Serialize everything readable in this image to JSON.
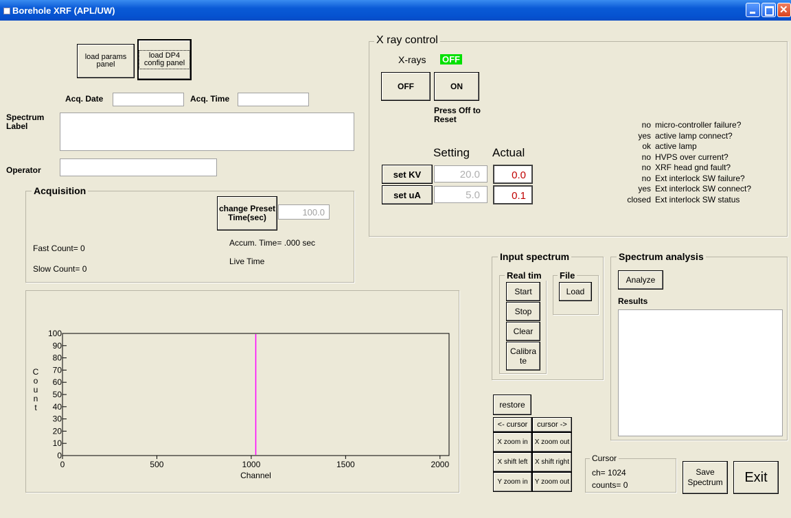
{
  "window": {
    "title": "Borehole XRF (APL/UW)"
  },
  "top_buttons": {
    "load_params": "load params panel",
    "load_dp4": "load DP4 config panel"
  },
  "acq": {
    "date_label": "Acq. Date",
    "time_label": "Acq. Time",
    "date_value": "",
    "time_value": ""
  },
  "spectrum_label": {
    "label": "Spectrum Label",
    "value": ""
  },
  "operator": {
    "label": "Operator",
    "value": ""
  },
  "acquisition": {
    "title": "Acquisition",
    "change_preset": "change Preset Time(sec)",
    "preset_value": "100.0",
    "accum_time": "Accum. Time=  .000 sec",
    "live_time": "Live Time",
    "fast_count": "Fast Count= 0",
    "slow_count": "Slow Count= 0"
  },
  "xray": {
    "title": "X ray control",
    "xrays_label": "X-rays",
    "status": "OFF",
    "status_color": "#00e000",
    "off_button": "OFF",
    "on_button": "ON",
    "reset_note": "Press Off to Reset",
    "setting_header": "Setting",
    "actual_header": "Actual",
    "set_kv": "set KV",
    "set_ua": "set uA",
    "kv_setting": "20.0",
    "ua_setting": "5.0",
    "kv_actual": "0.0",
    "ua_actual": "0.1",
    "actual_color": "#c00000",
    "status_items": [
      {
        "value": "no",
        "label": "micro-controller failure?"
      },
      {
        "value": "yes",
        "label": "active lamp connect?"
      },
      {
        "value": "ok",
        "label": "active lamp"
      },
      {
        "value": "no",
        "label": "HVPS over current?"
      },
      {
        "value": "no",
        "label": "XRF head gnd fault?"
      },
      {
        "value": "no",
        "label": "Ext interlock SW failure?"
      },
      {
        "value": "yes",
        "label": "Ext interlock SW connect?"
      },
      {
        "value": "closed",
        "label": "Ext interlock SW status"
      }
    ]
  },
  "input_spectrum": {
    "title": "Input spectrum",
    "realtime_title": "Real tim",
    "file_title": "File",
    "start": "Start",
    "stop": "Stop",
    "clear": "Clear",
    "calibrate": "Calibra te",
    "load": "Load"
  },
  "analysis": {
    "title": "Spectrum analysis",
    "analyze": "Analyze",
    "results_label": "Results",
    "results_value": ""
  },
  "nav": {
    "restore": "restore",
    "cursor_left": "<- cursor",
    "cursor_right": "cursor ->",
    "x_zoom_in": "X zoom in",
    "x_zoom_out": "X zoom out",
    "x_shift_left": "X shift left",
    "x_shift_right": "X shift right",
    "y_zoom_in": "Y zoom in",
    "y_zoom_out": "Y zoom out"
  },
  "cursor": {
    "title": "Cursor",
    "ch": "ch= 1024",
    "counts": "counts= 0"
  },
  "actions": {
    "save": "Save Spectrum",
    "exit": "Exit"
  },
  "chart_data": {
    "type": "line",
    "xlabel": "Channel",
    "ylabel": "Count",
    "xlim": [
      0,
      2048
    ],
    "ylim": [
      0,
      100
    ],
    "x_ticks": [
      0,
      500,
      1000,
      1500,
      2000
    ],
    "y_ticks": [
      0,
      10,
      20,
      30,
      40,
      50,
      60,
      70,
      80,
      90,
      100
    ],
    "cursor_channel": 1024,
    "cursor_color": "#ff00ff",
    "values": []
  }
}
